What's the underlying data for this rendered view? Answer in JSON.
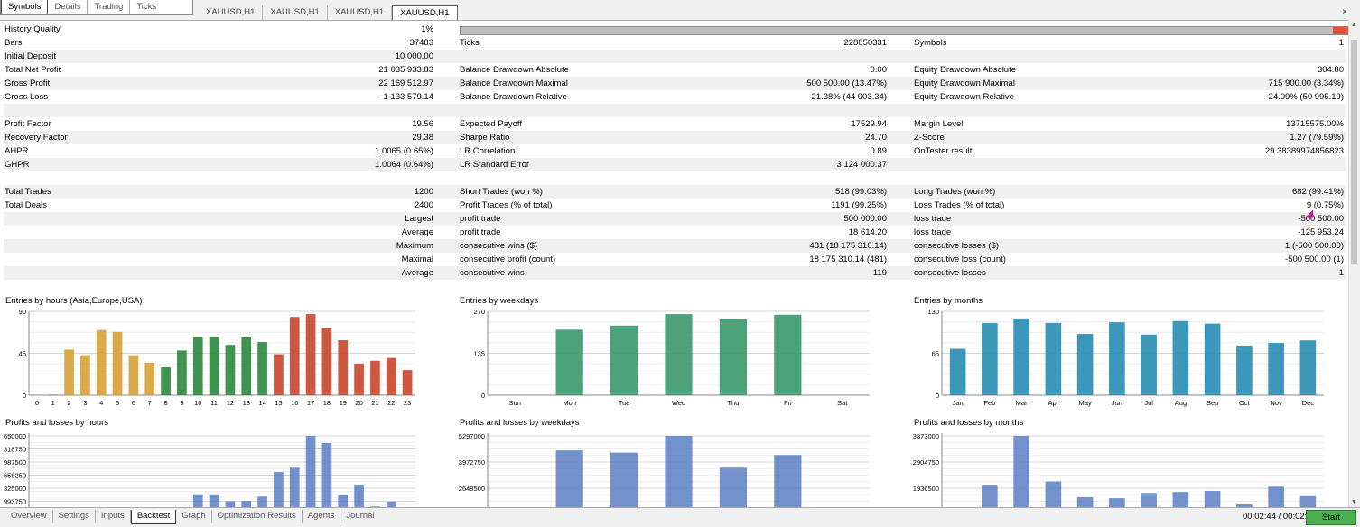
{
  "top_tabs": [
    "Symbols",
    "Details",
    "Trading",
    "Ticks"
  ],
  "chart_tabs": [
    "XAUUSD,H1",
    "XAUUSD,H1",
    "XAUUSD,H1",
    "XAUUSD,H1"
  ],
  "close_label": "×",
  "history_quality": {
    "label": "History Quality",
    "value": "1%"
  },
  "rows": [
    {
      "l1": "Bars",
      "v1": "37483",
      "l2": "Ticks",
      "v2": "228850331",
      "l3": "Symbols",
      "v3": "1"
    },
    {
      "l1": "Initial Deposit",
      "v1": "10 000.00",
      "l2": "",
      "v2": "",
      "l3": "",
      "v3": ""
    },
    {
      "l1": "Total Net Profit",
      "v1": "21 035 933.83",
      "l2": "Balance Drawdown Absolute",
      "v2": "0.00",
      "l3": "Equity Drawdown Absolute",
      "v3": "304.80"
    },
    {
      "l1": "Gross Profit",
      "v1": "22 169 512.97",
      "l2": "Balance Drawdown Maximal",
      "v2": "500 500.00 (13.47%)",
      "l3": "Equity Drawdown Maximal",
      "v3": "715 900.00 (3.34%)"
    },
    {
      "l1": "Gross Loss",
      "v1": "-1 133 579.14",
      "l2": "Balance Drawdown Relative",
      "v2": "21.38% (44 903.34)",
      "l3": "Equity Drawdown Relative",
      "v3": "24.09% (50 995.19)"
    },
    {
      "l1": "",
      "v1": "",
      "l2": "",
      "v2": "",
      "l3": "",
      "v3": ""
    },
    {
      "l1": "Profit Factor",
      "v1": "19.56",
      "l2": "Expected Payoff",
      "v2": "17529.94",
      "l3": "Margin Level",
      "v3": "13715575.00%"
    },
    {
      "l1": "Recovery Factor",
      "v1": "29.38",
      "l2": "Sharpe Ratio",
      "v2": "24.70",
      "l3": "Z-Score",
      "v3": "1.27 (79.59%)"
    },
    {
      "l1": "AHPR",
      "v1": "1.0065 (0.65%)",
      "l2": "LR Correlation",
      "v2": "0.89",
      "l3": "OnTester result",
      "v3": "29.38389974856823"
    },
    {
      "l1": "GHPR",
      "v1": "1.0064 (0.64%)",
      "l2": "LR Standard Error",
      "v2": "3 124 000.37",
      "l3": "",
      "v3": ""
    },
    {
      "l1": "",
      "v1": "",
      "l2": "",
      "v2": "",
      "l3": "",
      "v3": ""
    },
    {
      "l1": "Total Trades",
      "v1": "1200",
      "l2": "Short Trades (won %)",
      "v2": "518 (99.03%)",
      "l3": "Long Trades (won %)",
      "v3": "682 (99.41%)"
    },
    {
      "l1": "Total Deals",
      "v1": "2400",
      "l2": "Profit Trades (% of total)",
      "v2": "1191 (99.25%)",
      "l3": "Loss Trades (% of total)",
      "v3": "9 (0.75%)"
    },
    {
      "l1": "",
      "v1": "Largest",
      "l2": "profit trade",
      "v2": "500 000.00",
      "l3": "loss trade",
      "v3": "-500 500.00"
    },
    {
      "l1": "",
      "v1": "Average",
      "l2": "profit trade",
      "v2": "18 614.20",
      "l3": "loss trade",
      "v3": "-125 953.24"
    },
    {
      "l1": "",
      "v1": "Maximum",
      "l2": "consecutive wins ($)",
      "v2": "481 (18 175 310.14)",
      "l3": "consecutive losses ($)",
      "v3": "1 (-500 500.00)"
    },
    {
      "l1": "",
      "v1": "Maximal",
      "l2": "consecutive profit (count)",
      "v2": "18 175 310.14 (481)",
      "l3": "consecutive loss (count)",
      "v3": "-500 500.00 (1)"
    },
    {
      "l1": "",
      "v1": "Average",
      "l2": "consecutive wins",
      "v2": "119",
      "l3": "consecutive losses",
      "v3": "1"
    },
    {
      "l1": "",
      "v1": "",
      "l2": "",
      "v2": "",
      "l3": "",
      "v3": ""
    }
  ],
  "chart_data": [
    {
      "type": "bar",
      "title": "Entries by hours (Asia,Europe,USA)",
      "categories": [
        "0",
        "1",
        "2",
        "3",
        "4",
        "5",
        "6",
        "7",
        "8",
        "9",
        "10",
        "11",
        "12",
        "13",
        "14",
        "15",
        "16",
        "17",
        "18",
        "19",
        "20",
        "21",
        "22",
        "23"
      ],
      "values": [
        0,
        1,
        49,
        43,
        70,
        68,
        43,
        35,
        30,
        48,
        62,
        63,
        54,
        62,
        57,
        44,
        84,
        87,
        72,
        59,
        34,
        37,
        40,
        27
      ],
      "yticks": [
        "90",
        "45",
        "0"
      ],
      "ylim": [
        0,
        90
      ],
      "colors": [
        "#d7a23a",
        "#d7a23a",
        "#d7a23a",
        "#d7a23a",
        "#d7a23a",
        "#d7a23a",
        "#d7a23a",
        "#d7a23a",
        "#2f8a3f",
        "#2f8a3f",
        "#2f8a3f",
        "#2f8a3f",
        "#2f8a3f",
        "#2f8a3f",
        "#2f8a3f",
        "#c84a32",
        "#c84a32",
        "#c84a32",
        "#c84a32",
        "#c84a32",
        "#c84a32",
        "#c84a32",
        "#c84a32",
        "#c84a32"
      ]
    },
    {
      "type": "bar",
      "title": "Entries by weekdays",
      "categories": [
        "Sun",
        "Mon",
        "Tue",
        "Wed",
        "Thu",
        "Fri",
        "Sat"
      ],
      "values": [
        0,
        211,
        224,
        261,
        244,
        259,
        0
      ],
      "yticks": [
        "270",
        "135",
        "0"
      ],
      "ylim": [
        0,
        270
      ],
      "colors": [
        "#3d9b6e",
        "#3d9b6e",
        "#3d9b6e",
        "#3d9b6e",
        "#3d9b6e",
        "#3d9b6e",
        "#3d9b6e"
      ]
    },
    {
      "type": "bar",
      "title": "Entries by months",
      "categories": [
        "Jan",
        "Feb",
        "Mar",
        "Apr",
        "May",
        "Jun",
        "Jul",
        "Aug",
        "Sep",
        "Oct",
        "Nov",
        "Dec"
      ],
      "values": [
        72,
        112,
        119,
        112,
        95,
        113,
        94,
        115,
        111,
        77,
        81,
        85
      ],
      "yticks": [
        "130",
        "65",
        "0"
      ],
      "ylim": [
        0,
        130
      ],
      "colors": [
        "#2b8fb5",
        "#2b8fb5",
        "#2b8fb5",
        "#2b8fb5",
        "#2b8fb5",
        "#2b8fb5",
        "#2b8fb5",
        "#2b8fb5",
        "#2b8fb5",
        "#2b8fb5",
        "#2b8fb5",
        "#2b8fb5"
      ]
    },
    {
      "type": "bar",
      "title": "Profits and losses by hours",
      "categories": [
        "0",
        "1",
        "2",
        "3",
        "4",
        "5",
        "6",
        "7",
        "8",
        "9",
        "10",
        "11",
        "12",
        "13",
        "14",
        "15",
        "16",
        "17",
        "18",
        "19",
        "20",
        "21",
        "22",
        "23"
      ],
      "values": [
        0,
        0,
        245000,
        290000,
        0,
        550000,
        690000,
        230000,
        815000,
        0,
        2330000,
        2330000,
        1600000,
        1660000,
        2090000,
        4590000,
        5040000,
        8280000,
        7550000,
        2230000,
        3210000,
        1080000,
        1580000,
        680000
      ],
      "yticks": [
        "650000",
        "318750",
        "987500",
        "656250",
        "325000",
        "993750",
        "662500"
      ],
      "ylim": [
        0,
        8280000
      ],
      "colors": [
        "#5b7fc4"
      ]
    },
    {
      "type": "bar",
      "title": "Profits and losses by weekdays",
      "categories": [
        "Sun",
        "Mon",
        "Tue",
        "Wed",
        "Thu",
        "Fri",
        "Sat"
      ],
      "values": [
        0,
        4350000,
        4200000,
        5297000,
        3220000,
        4050000,
        0
      ],
      "yticks": [
        "5297000",
        "3972750",
        "2648500",
        "1324250"
      ],
      "ylim": [
        0,
        5297000
      ],
      "colors": [
        "#5b7fc4"
      ]
    },
    {
      "type": "bar",
      "title": "Profits and losses by months",
      "categories": [
        "Jan",
        "Feb",
        "Mar",
        "Apr",
        "May",
        "Jun",
        "Jul",
        "Aug",
        "Sep",
        "Oct",
        "Nov",
        "Dec"
      ],
      "values": [
        200000,
        1500000,
        3873000,
        1700000,
        950000,
        900000,
        1150000,
        1200000,
        1250000,
        600000,
        1450000,
        1000000
      ],
      "yticks": [
        "3873000",
        "2904750",
        "1936500",
        "968250"
      ],
      "ylim": [
        0,
        3873000
      ],
      "colors": [
        "#5b7fc4"
      ]
    }
  ],
  "bottom_tabs": [
    "Overview",
    "Settings",
    "Inputs",
    "Backtest",
    "Graph",
    "Optimization Results",
    "Agents",
    "Journal"
  ],
  "timer": "00:02:44 / 00:02:44",
  "start_label": "Start"
}
